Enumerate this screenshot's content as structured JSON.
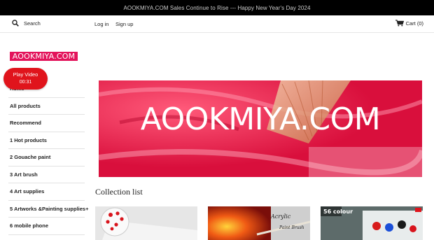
{
  "announcement": "AOOKMIYA.COM Sales Continue to Rise --- Happy New Year's Day 2024",
  "header": {
    "search_label": "Search",
    "login": "Log in",
    "signup": "Sign up",
    "cart": "Cart (0)"
  },
  "logo": "AOOKMIYA.COM",
  "video": {
    "label": "Play Video",
    "time": "00:31"
  },
  "nav": [
    "Home",
    "All products",
    "Recommend",
    "1 Hot products",
    "2 Gouache paint",
    "3 Art brush",
    "4 Art supplies",
    "5 Artworks &Painting supplies+",
    "6 mobile phone"
  ],
  "hero_text": "AOOKMIYA.COM",
  "collection_title": "Collection list",
  "cards": {
    "card2_text1": "Acrylic",
    "card2_text2": "Paint Brush",
    "card3_text": "56 colour"
  },
  "colors": {
    "accent": "#e3145b",
    "video_red": "#e0141c",
    "announce_bg": "#000000"
  }
}
